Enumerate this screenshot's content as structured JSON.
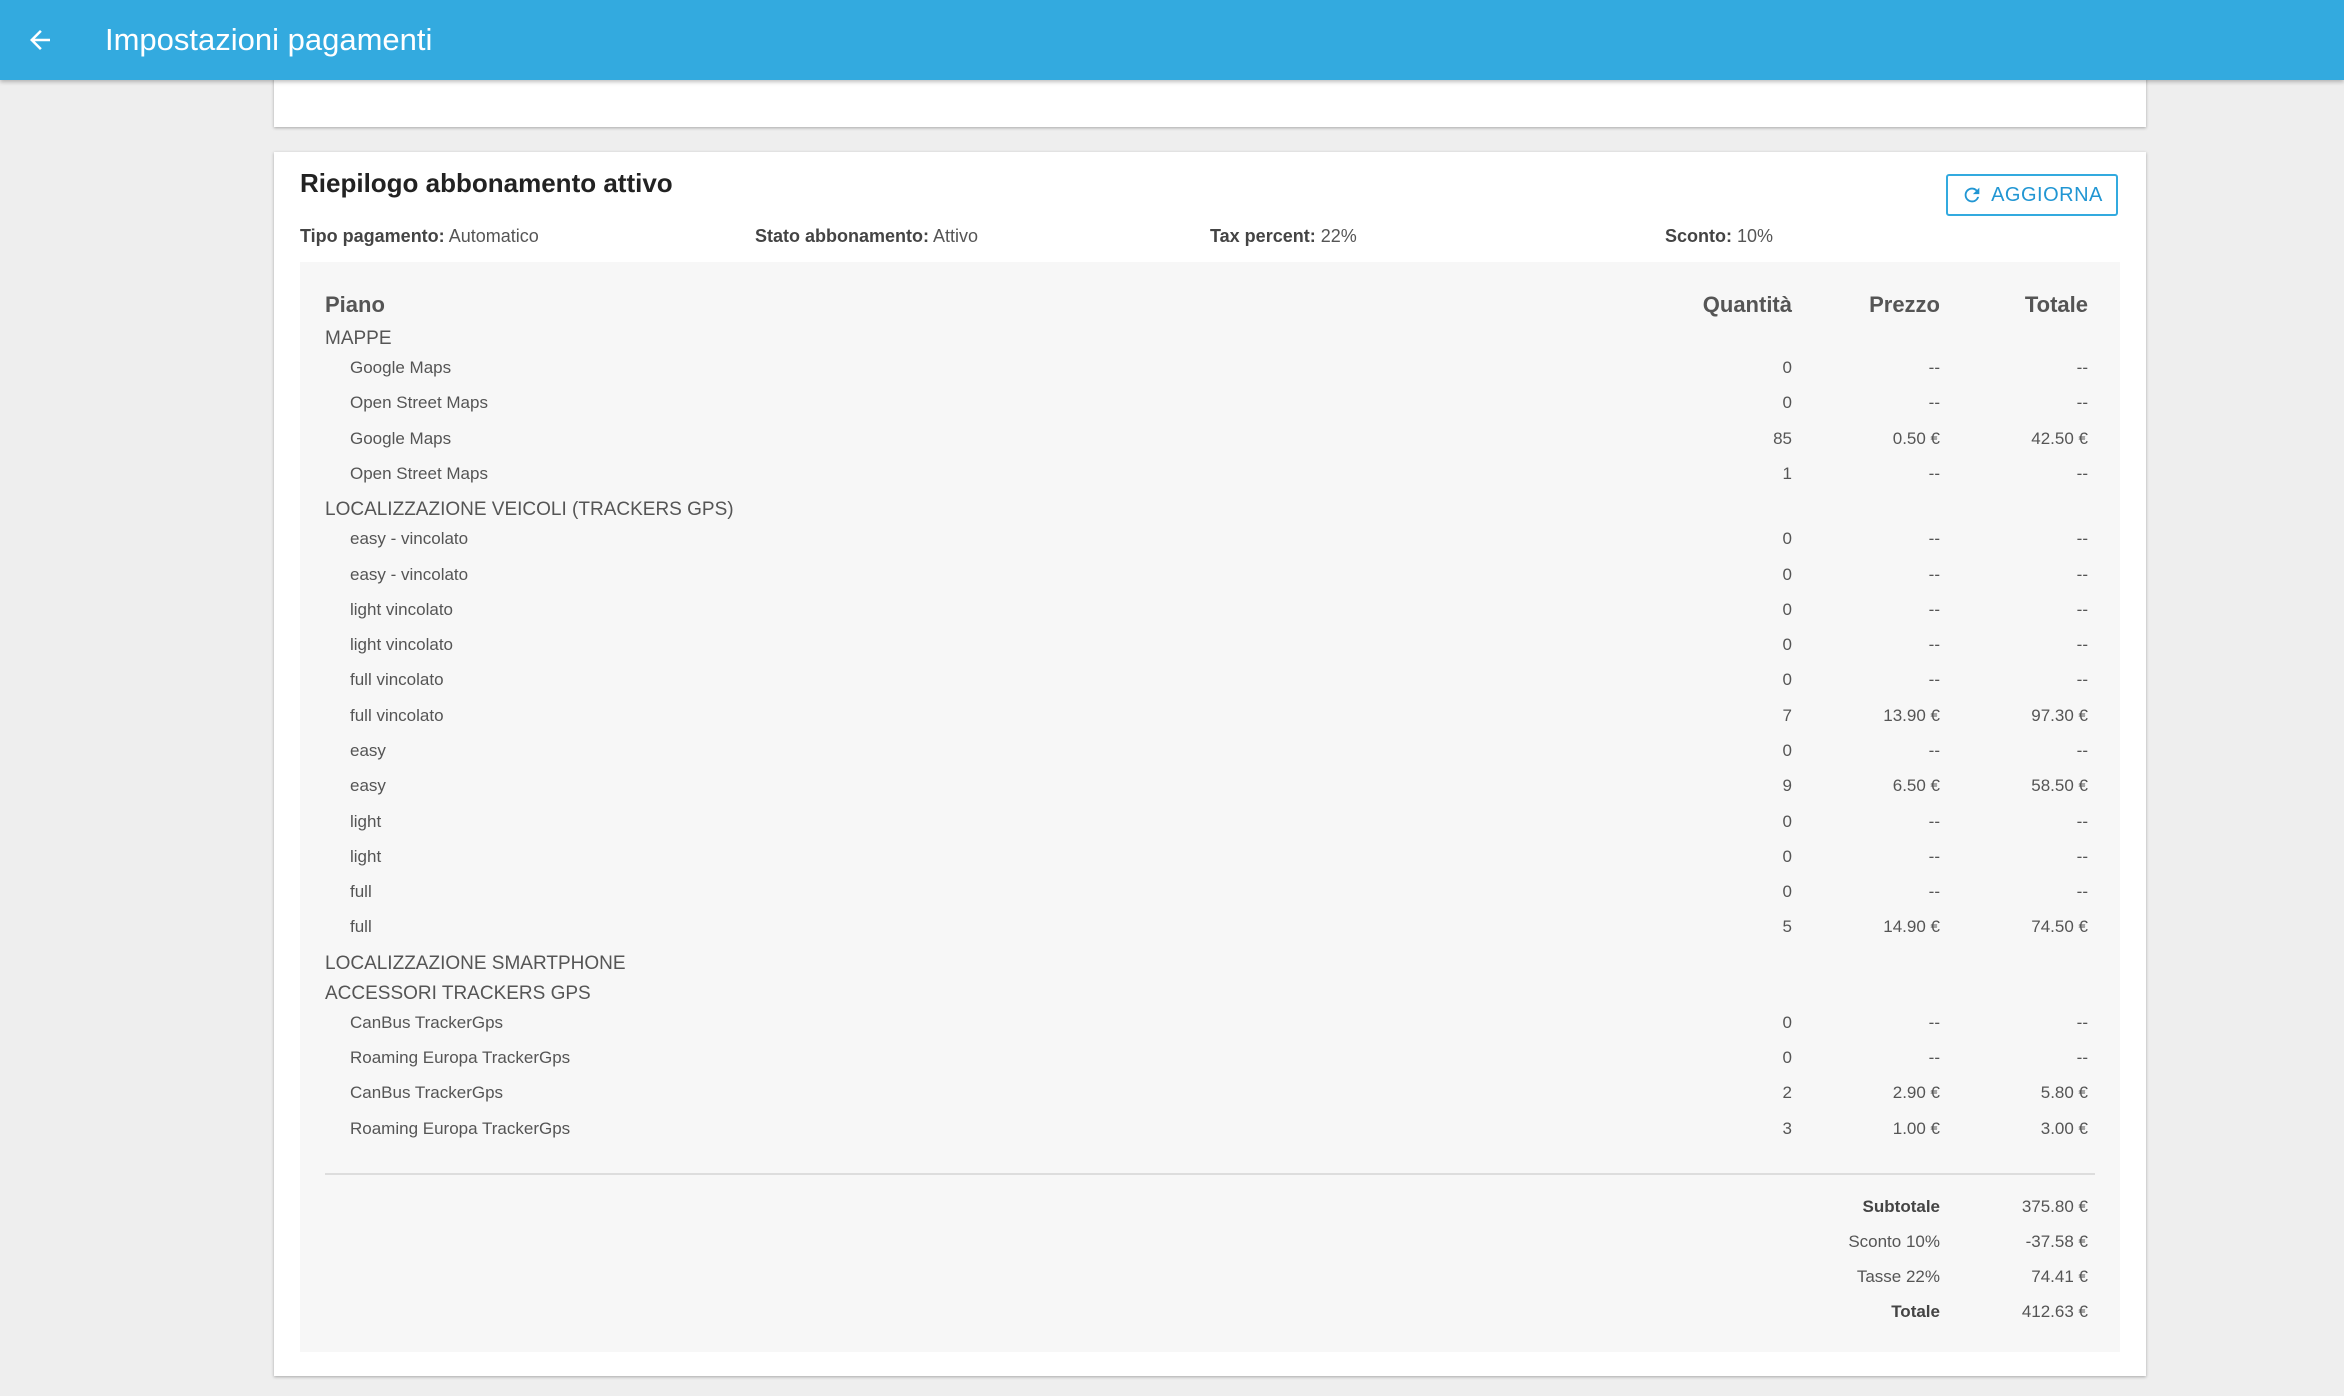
{
  "appbar": {
    "title": "Impostazioni pagamenti"
  },
  "card": {
    "title": "Riepilogo abbonamento attivo",
    "refresh_label": "AGGIORNA",
    "info": {
      "payment_type_label": "Tipo pagamento:",
      "payment_type_value": "Automatico",
      "status_label": "Stato abbonamento:",
      "status_value": "Attivo",
      "tax_label": "Tax percent:",
      "tax_value": "22%",
      "discount_label": "Sconto:",
      "discount_value": "10%"
    },
    "table": {
      "headers": {
        "plan": "Piano",
        "quantity": "Quantità",
        "price": "Prezzo",
        "total": "Totale"
      },
      "rows": [
        {
          "type": "category",
          "name": "MAPPE"
        },
        {
          "type": "item",
          "name": "Google Maps",
          "qty": "0",
          "price": "--",
          "total": "--"
        },
        {
          "type": "item",
          "name": "Open Street Maps",
          "qty": "0",
          "price": "--",
          "total": "--"
        },
        {
          "type": "item",
          "name": "Google Maps",
          "qty": "85",
          "price": "0.50 €",
          "total": "42.50 €"
        },
        {
          "type": "item",
          "name": "Open Street Maps",
          "qty": "1",
          "price": "--",
          "total": "--"
        },
        {
          "type": "category",
          "name": "LOCALIZZAZIONE VEICOLI (TRACKERS GPS)"
        },
        {
          "type": "item",
          "name": "easy - vincolato",
          "qty": "0",
          "price": "--",
          "total": "--"
        },
        {
          "type": "item",
          "name": "easy - vincolato",
          "qty": "0",
          "price": "--",
          "total": "--"
        },
        {
          "type": "item",
          "name": "light vincolato",
          "qty": "0",
          "price": "--",
          "total": "--"
        },
        {
          "type": "item",
          "name": "light vincolato",
          "qty": "0",
          "price": "--",
          "total": "--"
        },
        {
          "type": "item",
          "name": "full vincolato",
          "qty": "0",
          "price": "--",
          "total": "--"
        },
        {
          "type": "item",
          "name": "full vincolato",
          "qty": "7",
          "price": "13.90 €",
          "total": "97.30 €"
        },
        {
          "type": "item",
          "name": "easy",
          "qty": "0",
          "price": "--",
          "total": "--"
        },
        {
          "type": "item",
          "name": "easy",
          "qty": "9",
          "price": "6.50 €",
          "total": "58.50 €"
        },
        {
          "type": "item",
          "name": "light",
          "qty": "0",
          "price": "--",
          "total": "--"
        },
        {
          "type": "item",
          "name": "light",
          "qty": "0",
          "price": "--",
          "total": "--"
        },
        {
          "type": "item",
          "name": "full",
          "qty": "0",
          "price": "--",
          "total": "--"
        },
        {
          "type": "item",
          "name": "full",
          "qty": "5",
          "price": "14.90 €",
          "total": "74.50 €"
        },
        {
          "type": "category",
          "name": "LOCALIZZAZIONE SMARTPHONE"
        },
        {
          "type": "category",
          "name": "ACCESSORI TRACKERS GPS"
        },
        {
          "type": "item",
          "name": "CanBus TrackerGps",
          "qty": "0",
          "price": "--",
          "total": "--"
        },
        {
          "type": "item",
          "name": "Roaming Europa TrackerGps",
          "qty": "0",
          "price": "--",
          "total": "--"
        },
        {
          "type": "item",
          "name": "CanBus TrackerGps",
          "qty": "2",
          "price": "2.90 €",
          "total": "5.80 €"
        },
        {
          "type": "item",
          "name": "Roaming Europa TrackerGps",
          "qty": "3",
          "price": "1.00 €",
          "total": "3.00 €"
        }
      ]
    },
    "summary": [
      {
        "label": "Subtotale",
        "value": "375.80 €",
        "bold": true
      },
      {
        "label": "Sconto 10%",
        "value": "-37.58 €",
        "bold": false
      },
      {
        "label": "Tasse 22%",
        "value": "74.41 €",
        "bold": false
      },
      {
        "label": "Totale",
        "value": "412.63 €",
        "bold": true
      }
    ]
  },
  "colors": {
    "appbar": "#33aadf",
    "accent": "#2196d3",
    "background": "#eeeeee",
    "panel": "#f7f7f7"
  },
  "icons": {
    "back": "arrow-left-icon",
    "refresh": "refresh-icon"
  }
}
